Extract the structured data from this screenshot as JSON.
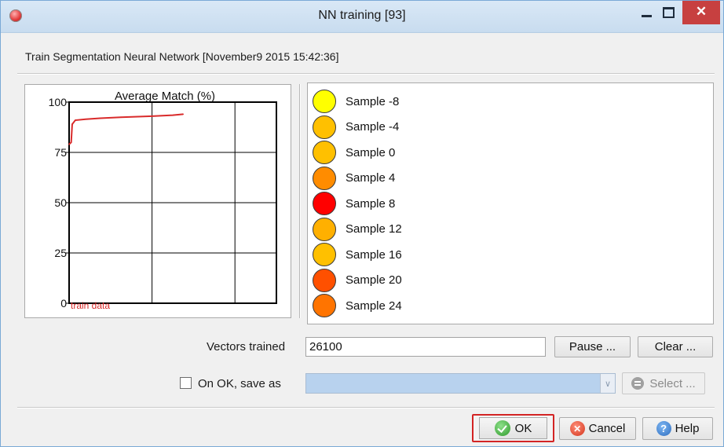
{
  "window": {
    "title": "NN training [93]",
    "icon": "app-icon",
    "close_symbol": "✕"
  },
  "header": {
    "label": "Train Segmentation Neural Network [November9 2015 15:42:36]"
  },
  "chart_data": {
    "type": "line",
    "title": "Average Match (%)",
    "xlabel": "",
    "ylabel": "",
    "ylim": [
      0,
      100
    ],
    "yticks": [
      "0",
      "25",
      "50",
      "75",
      "100"
    ],
    "xlim": [
      0,
      100
    ],
    "grid": true,
    "series": [
      {
        "name": "train data",
        "color": "#d92b2b",
        "x": [
          0,
          1,
          1.5,
          3,
          8,
          15,
          25,
          40,
          50,
          55
        ],
        "y": [
          79,
          80,
          89,
          91,
          91.5,
          92,
          92.5,
          93,
          93.5,
          94
        ]
      }
    ]
  },
  "samples": [
    {
      "label": "Sample -8",
      "color": "#ffff00"
    },
    {
      "label": "Sample -4",
      "color": "#ffc000"
    },
    {
      "label": "Sample 0",
      "color": "#ffc000"
    },
    {
      "label": "Sample 4",
      "color": "#ff8c00"
    },
    {
      "label": "Sample 8",
      "color": "#ff0000"
    },
    {
      "label": "Sample 12",
      "color": "#ffb000"
    },
    {
      "label": "Sample 16",
      "color": "#ffc000"
    },
    {
      "label": "Sample 20",
      "color": "#ff5000"
    },
    {
      "label": "Sample 24",
      "color": "#ff7400"
    }
  ],
  "vectors": {
    "label": "Vectors trained",
    "value": "26100"
  },
  "buttons": {
    "pause": "Pause ...",
    "clear": "Clear ...",
    "select": "Select ...",
    "ok": "OK",
    "cancel": "Cancel",
    "help": "Help"
  },
  "save_as": {
    "label": "On OK, save as",
    "checked": false,
    "value": "",
    "arrow": "∨"
  }
}
